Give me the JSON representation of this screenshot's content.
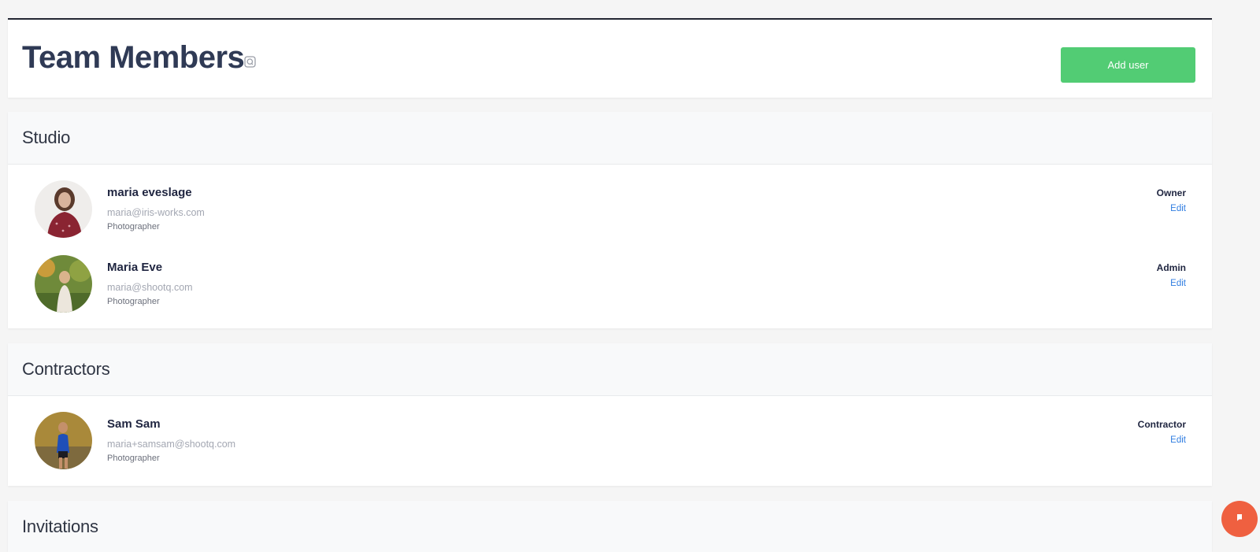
{
  "header": {
    "title": "Team Members",
    "add_user_label": "Add user"
  },
  "sections": [
    {
      "title": "Studio",
      "members": [
        {
          "name": "maria eveslage",
          "email": "maria@iris-works.com",
          "job_title": "Photographer",
          "role": "Owner",
          "edit_label": "Edit"
        },
        {
          "name": "Maria Eve",
          "email": "maria@shootq.com",
          "job_title": "Photographer",
          "role": "Admin",
          "edit_label": "Edit"
        }
      ]
    },
    {
      "title": "Contractors",
      "members": [
        {
          "name": "Sam Sam",
          "email": "maria+samsam@shootq.com",
          "job_title": "Photographer",
          "role": "Contractor",
          "edit_label": "Edit"
        }
      ]
    },
    {
      "title": "Invitations",
      "members": []
    }
  ],
  "colors": {
    "accent_green": "#52cc74",
    "link_blue": "#2f7de1",
    "chat_orange": "#ef6040"
  },
  "icons": {
    "help": "help-icon",
    "chat": "chat-icon"
  }
}
